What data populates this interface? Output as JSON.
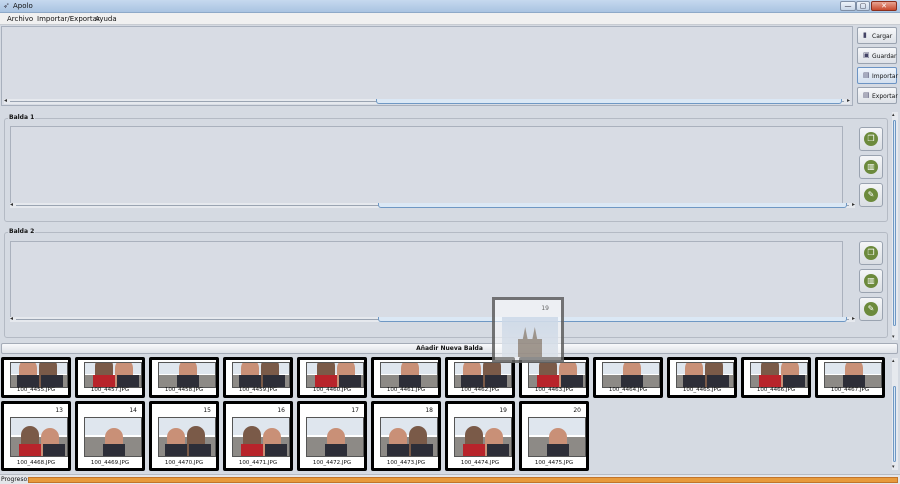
{
  "window": {
    "title": "Apolo",
    "min": "—",
    "max": "▢",
    "close": "✕"
  },
  "menu": [
    {
      "label": "Archivo"
    },
    {
      "label": "Importar/Exportar"
    },
    {
      "label": "Ayuda"
    }
  ],
  "top_buttons": [
    {
      "label": "Cargar",
      "icon": "folder-icon"
    },
    {
      "label": "Guardar",
      "icon": "save-icon"
    },
    {
      "label": "Importar",
      "icon": "import-icon"
    },
    {
      "label": "Exportar",
      "icon": "export-icon"
    }
  ],
  "shelves": [
    {
      "title": "Balda 1"
    },
    {
      "title": "Balda 2"
    }
  ],
  "shelf_actions": [
    "copy-icon",
    "delete-icon",
    "edit-icon"
  ],
  "add_shelf_label": "Añadir Nueva Balda",
  "gallery_row1": [
    {
      "file": "100_4455.JPG"
    },
    {
      "file": "100_4457.JPG"
    },
    {
      "file": "100_4458.JPG"
    },
    {
      "file": "100_4459.JPG"
    },
    {
      "file": "100_4460.JPG"
    },
    {
      "file": "100_4461.JPG"
    },
    {
      "file": "100_4462.JPG"
    },
    {
      "file": "100_4463.JPG"
    },
    {
      "file": "100_4464.JPG"
    },
    {
      "file": "100_4465.JPG"
    },
    {
      "file": "100_4466.JPG"
    },
    {
      "file": "100_4467.JPG"
    }
  ],
  "gallery_row2": [
    {
      "num": "13",
      "file": "100_4468.JPG"
    },
    {
      "num": "14",
      "file": "100_4469.JPG"
    },
    {
      "num": "15",
      "file": "100_4470.JPG"
    },
    {
      "num": "16",
      "file": "100_4471.JPG"
    },
    {
      "num": "17",
      "file": "100_4472.JPG"
    },
    {
      "num": "18",
      "file": "100_4473.JPG"
    },
    {
      "num": "19",
      "file": "100_4474.JPG"
    },
    {
      "num": "20",
      "file": "100_4475.JPG"
    }
  ],
  "dragged": {
    "num": "19"
  },
  "status": {
    "progress_label": "Progreso:",
    "progress": 1.0
  }
}
